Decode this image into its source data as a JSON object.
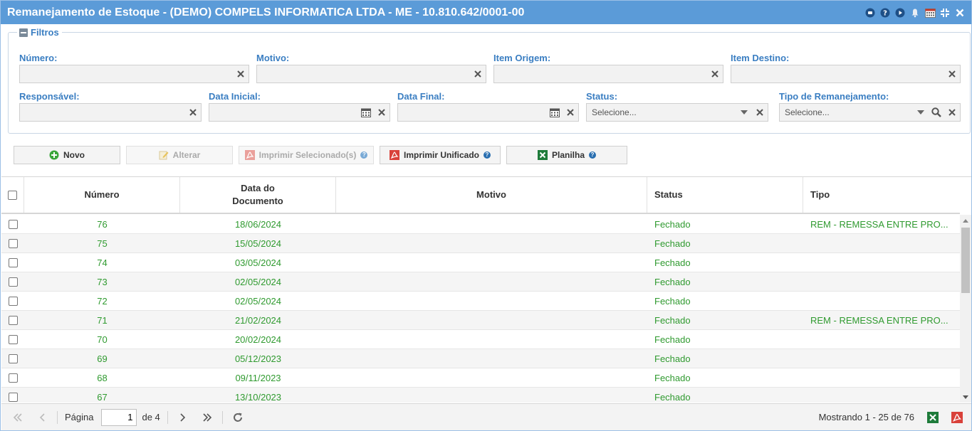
{
  "window": {
    "title": "Remanejamento de Estoque - (DEMO) COMPELS INFORMATICA LTDA - ME - 10.810.642/0001-00"
  },
  "filters": {
    "legend": "Filtros",
    "numero_label": "Número:",
    "motivo_label": "Motivo:",
    "item_origem_label": "Item Origem:",
    "item_destino_label": "Item Destino:",
    "responsavel_label": "Responsável:",
    "data_inicial_label": "Data Inicial:",
    "data_final_label": "Data Final:",
    "status_label": "Status:",
    "status_placeholder": "Selecione...",
    "tipo_label": "Tipo de Remanejamento:",
    "tipo_placeholder": "Selecione..."
  },
  "toolbar": {
    "novo": "Novo",
    "alterar": "Alterar",
    "imprimir_selecionados": "Imprimir Selecionado(s)",
    "imprimir_unificado": "Imprimir Unificado",
    "planilha": "Planilha"
  },
  "grid": {
    "columns": {
      "numero": "Número",
      "data_line1": "Data do",
      "data_line2": "Documento",
      "motivo": "Motivo",
      "status": "Status",
      "tipo": "Tipo"
    },
    "rows": [
      {
        "numero": "76",
        "data": "18/06/2024",
        "motivo": "",
        "status": "Fechado",
        "tipo": "REM - REMESSA ENTRE PRO..."
      },
      {
        "numero": "75",
        "data": "15/05/2024",
        "motivo": "",
        "status": "Fechado",
        "tipo": ""
      },
      {
        "numero": "74",
        "data": "03/05/2024",
        "motivo": "",
        "status": "Fechado",
        "tipo": ""
      },
      {
        "numero": "73",
        "data": "02/05/2024",
        "motivo": "",
        "status": "Fechado",
        "tipo": ""
      },
      {
        "numero": "72",
        "data": "02/05/2024",
        "motivo": "",
        "status": "Fechado",
        "tipo": ""
      },
      {
        "numero": "71",
        "data": "21/02/2024",
        "motivo": "",
        "status": "Fechado",
        "tipo": "REM - REMESSA ENTRE PRO..."
      },
      {
        "numero": "70",
        "data": "20/02/2024",
        "motivo": "",
        "status": "Fechado",
        "tipo": ""
      },
      {
        "numero": "69",
        "data": "05/12/2023",
        "motivo": "",
        "status": "Fechado",
        "tipo": ""
      },
      {
        "numero": "68",
        "data": "09/11/2023",
        "motivo": "",
        "status": "Fechado",
        "tipo": ""
      },
      {
        "numero": "67",
        "data": "13/10/2023",
        "motivo": "",
        "status": "Fechado",
        "tipo": ""
      }
    ]
  },
  "pager": {
    "pagina_label": "Página",
    "current_page": "1",
    "de_label": "de 4",
    "summary": "Mostrando 1 - 25 de 76"
  },
  "colors": {
    "titlebar": "#5b9bd8",
    "label_blue": "#3a7ec2",
    "row_text_green": "#2f9a2f",
    "excel_green": "#1e7b3a",
    "pdf_red": "#d9413a"
  }
}
